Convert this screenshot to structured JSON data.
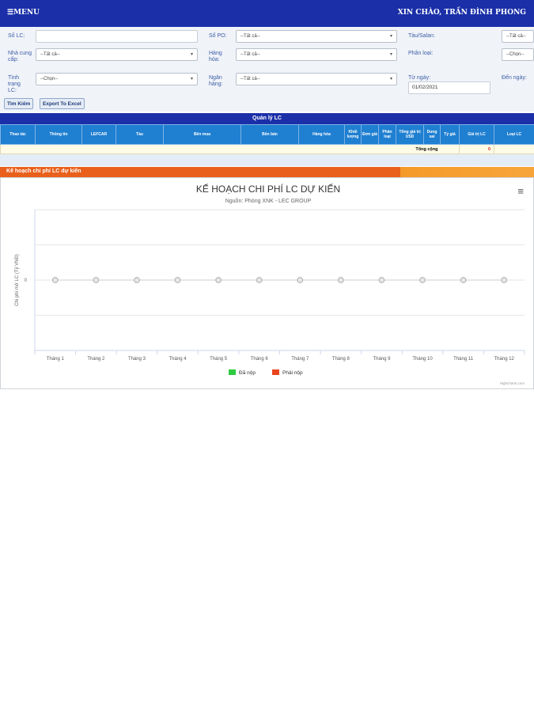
{
  "header": {
    "menu_label": "☰MENU",
    "greeting": "XIN CHÀO, TRẦN ĐÌNH PHONG"
  },
  "filters": {
    "so_lc_label": "Số LC:",
    "so_lc_value": "",
    "so_po_label": "Số PO:",
    "so_po_value": "--Tất cả--",
    "tau_salan_label": "Tàu/Salan:",
    "tau_salan_value": "--Tất cả--",
    "nha_cung_cap_label": "Nhà cung cấp:",
    "nha_cung_cap_value": "--Tất cả--",
    "hang_hoa_label": "Hàng hóa:",
    "hang_hoa_value": "--Tất cả--",
    "phan_loai_label": "Phân loại:",
    "phan_loai_value": "--Chọn--",
    "tinh_trang_label": "Tình trạng LC:",
    "tinh_trang_value": "--Chọn--",
    "ngan_hang_label": "Ngân hàng:",
    "ngan_hang_value": "--Tất cả--",
    "tu_ngay_label": "Từ ngày:",
    "tu_ngay_value": "01/02/2021",
    "den_ngay_label": "Đến ngày:",
    "search_button": "Tìm Kiếm",
    "export_button": "Export To Excel"
  },
  "lc_table": {
    "title": "Quản lý LC",
    "columns": [
      "Thao tác",
      "Thông tin",
      "LEFCAR",
      "Tàu",
      "Bên mua",
      "Bên bán",
      "Hàng hóa",
      "Khối lượng",
      "Đơn giá",
      "Phân loại",
      "Tổng giá trị USD",
      "Dung sai",
      "Tỷ giá",
      "Giá trị LC",
      "Loại LC"
    ],
    "total_label": "Tổng cộng",
    "total_value": "0"
  },
  "plan": {
    "bar_title": "Kế hoạch chi phí LC dự kiến"
  },
  "chart_data": {
    "type": "line",
    "title": "KẾ HOẠCH CHI PHÍ LC DỰ KIẾN",
    "subtitle": "Nguồn: Phòng XNK - LEC GROUP",
    "ylabel": "Chi phí mở LC (Tỷ VNĐ)",
    "xlabel": "",
    "categories": [
      "Tháng 1",
      "Tháng 2",
      "Tháng 3",
      "Tháng 4",
      "Tháng 5",
      "Tháng 6",
      "Tháng 7",
      "Tháng 8",
      "Tháng 9",
      "Tháng 10",
      "Tháng 11",
      "Tháng 12"
    ],
    "series": [
      {
        "name": "Đã nộp",
        "color": "#2ecc40",
        "values": [
          0,
          0,
          0,
          0,
          0,
          0,
          0,
          0,
          0,
          0,
          0,
          0
        ]
      },
      {
        "name": "Phải nộp",
        "color": "#e8451c",
        "values": [
          0,
          0,
          0,
          0,
          0,
          0,
          0,
          0,
          0,
          0,
          0,
          0
        ]
      }
    ],
    "yticks": [
      "0"
    ],
    "ylim": [
      -1,
      1
    ],
    "grid": true,
    "legend_position": "bottom",
    "credits": "Highcharts.com"
  },
  "colors": {
    "header_blue": "#1a2fa8",
    "table_header_blue": "#1f7fd1",
    "plan_orange": "#e8601c"
  }
}
